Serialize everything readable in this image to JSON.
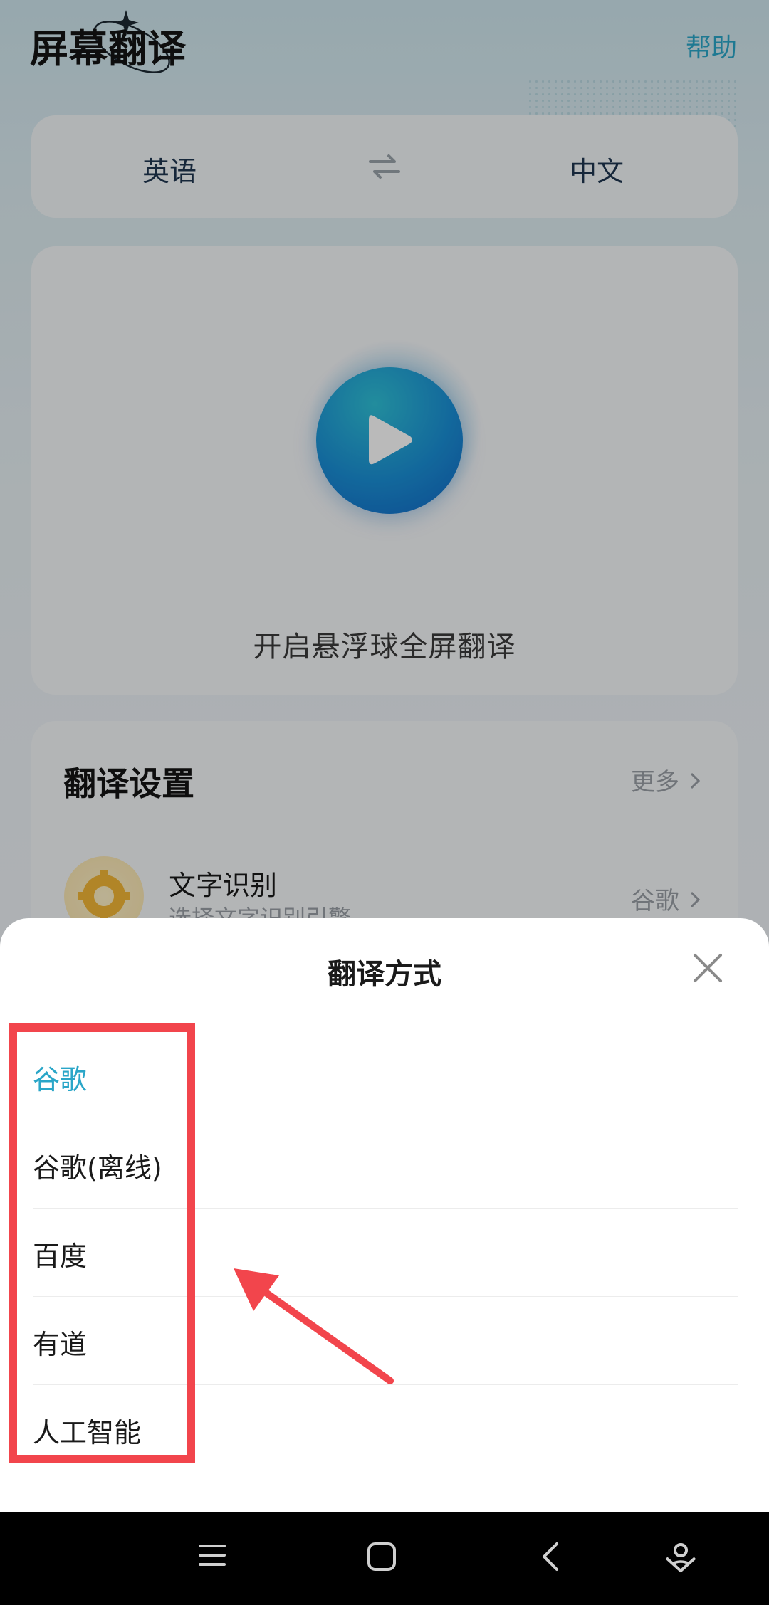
{
  "header": {
    "title": "屏幕翻译",
    "help": "帮助"
  },
  "languages": {
    "source": "英语",
    "target": "中文"
  },
  "main": {
    "start_label": "开启悬浮球全屏翻译"
  },
  "settings": {
    "title": "翻译设置",
    "more": "更多",
    "ocr": {
      "title": "文字识别",
      "subtitle": "选择文字识别引擎",
      "value": "谷歌"
    }
  },
  "sheet": {
    "title": "翻译方式",
    "options": [
      {
        "label": "谷歌",
        "selected": true
      },
      {
        "label": "谷歌(离线)",
        "selected": false
      },
      {
        "label": "百度",
        "selected": false
      },
      {
        "label": "有道",
        "selected": false
      },
      {
        "label": "人工智能",
        "selected": false
      }
    ]
  },
  "colors": {
    "accent": "#2aa6c8",
    "annotation": "#f2454c"
  }
}
